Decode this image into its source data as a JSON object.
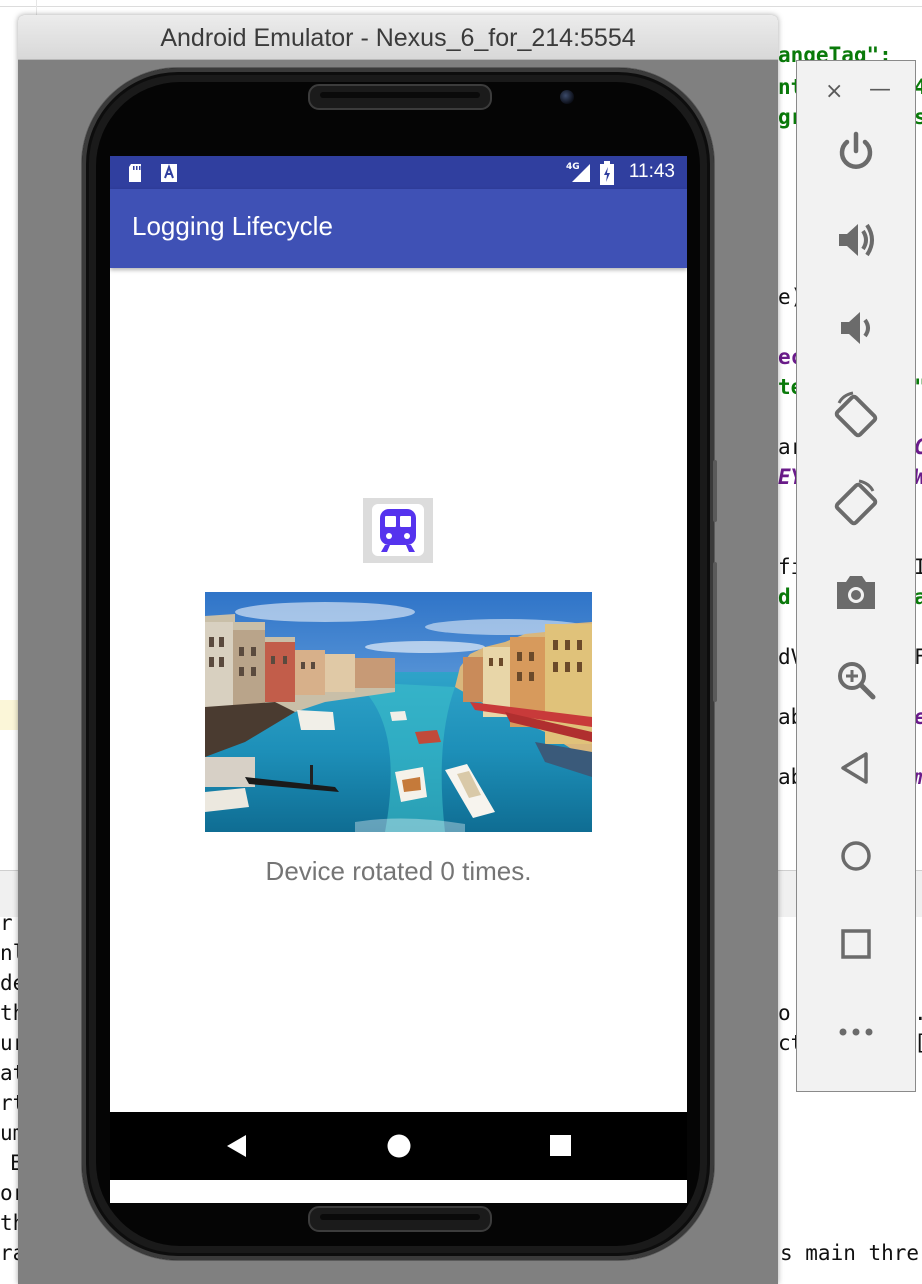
{
  "window": {
    "title": "Android Emulator - Nexus_6_for_214:5554"
  },
  "status_bar": {
    "time": "11:43",
    "network": "4G",
    "icons": [
      "sd-card-icon",
      "notification-a-icon",
      "signal-icon",
      "battery-icon"
    ]
  },
  "app": {
    "title": "Logging Lifecycle",
    "button_icon": "train-icon",
    "image_description_icon": "venice-canal-photo",
    "rotation_text": "Device rotated 0 times."
  },
  "nav_bar": {
    "buttons": [
      "back-icon",
      "home-icon",
      "recents-icon"
    ]
  },
  "emulator_toolbar": {
    "close_symbol": "×",
    "minimize_symbol": "—",
    "buttons": [
      "power-icon",
      "volume-up-icon",
      "volume-down-icon",
      "rotate-left-icon",
      "rotate-right-icon",
      "camera-icon",
      "zoom-icon",
      "back-icon",
      "home-icon",
      "overview-icon",
      "more-icon"
    ]
  },
  "background_code": {
    "line1": "angeTag\":",
    "line2a": "nt",
    "line2b": "4",
    "line3a": "gr",
    "line3b": "s",
    "line4": "e)",
    "line5": "ec",
    "line6a": "te",
    "line6b": "\"",
    "line7a": "ar",
    "line7b": "C",
    "line8a": "EY",
    "line8b": "W",
    "line9a": "fi",
    "line9b": "I",
    "line10a": "d",
    "line10b": "a",
    "line11a": "dV",
    "line11b": "F",
    "line12a": "ab",
    "line12b": "e",
    "line13a": "ab",
    "line13b": "m",
    "console_left": [
      "r",
      "nl",
      "de",
      "th",
      "ur",
      "at",
      "rt",
      "um",
      "E",
      "or",
      "th",
      "ra"
    ],
    "console_right1a": "o",
    "console_right1b": ".(",
    "console_right2a": "ct",
    "console_right2b": "[I",
    "console_bottom": "s main thre"
  }
}
